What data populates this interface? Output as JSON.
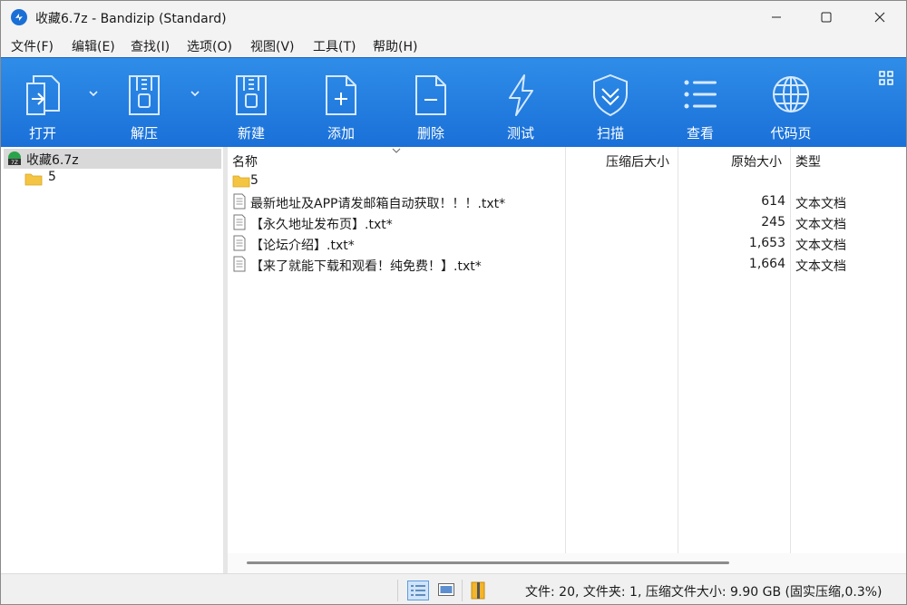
{
  "window": {
    "title": "收藏6.7z - Bandizip (Standard)"
  },
  "menu": [
    "文件(F)",
    "编辑(E)",
    "查找(I)",
    "选项(O)",
    "视图(V)",
    "工具(T)",
    "帮助(H)"
  ],
  "toolbar": {
    "open": "打开",
    "extract": "解压",
    "new": "新建",
    "add": "添加",
    "delete": "删除",
    "test": "测试",
    "scan": "扫描",
    "view": "查看",
    "codepage": "代码页"
  },
  "tree": {
    "root": "收藏6.7z",
    "child": "5"
  },
  "columns": {
    "name": "名称",
    "packed": "压缩后大小",
    "size": "原始大小",
    "type": "类型"
  },
  "files": [
    {
      "name": "5",
      "size": "",
      "type": "",
      "kind": "folder"
    },
    {
      "name": "最新地址及APP请发邮箱自动获取！！！.txt*",
      "size": "614",
      "type": "文本文档",
      "kind": "file"
    },
    {
      "name": "【永久地址发布页】.txt*",
      "size": "245",
      "type": "文本文档",
      "kind": "file"
    },
    {
      "name": "【论坛介绍】.txt*",
      "size": "1,653",
      "type": "文本文档",
      "kind": "file"
    },
    {
      "name": "【来了就能下载和观看！纯免费！】.txt*",
      "size": "1,664",
      "type": "文本文档",
      "kind": "file"
    }
  ],
  "status": {
    "text": "文件: 20, 文件夹: 1, 压缩文件大小: 9.90 GB (固实压缩,0.3%)"
  },
  "colors": {
    "toolbar": "#1f78dd",
    "selection": "#d9d9d9",
    "folder": "#f4c542"
  }
}
